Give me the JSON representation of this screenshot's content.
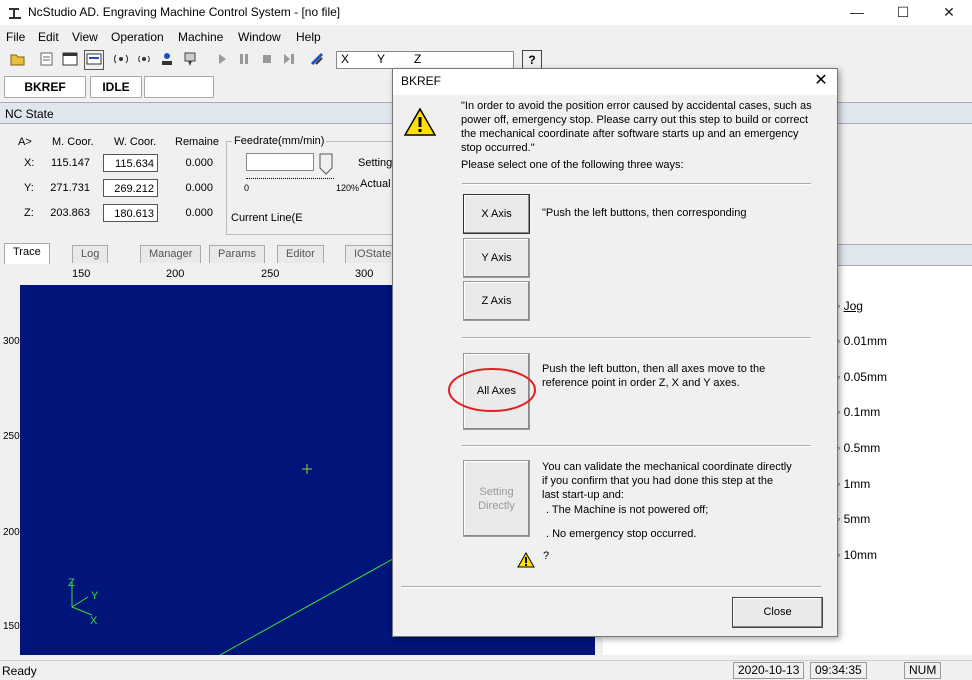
{
  "window": {
    "title": "NcStudio AD. Engraving Machine Control System  - [no file]",
    "minimize_glyph": "—",
    "maximize_glyph": "☐",
    "close_glyph": "✕"
  },
  "menu": [
    "File",
    "Edit",
    "View",
    "Operation",
    "Machine",
    "Window",
    "Help"
  ],
  "toolbar": {
    "axis_labels": [
      "X",
      "Y",
      "Z"
    ],
    "help_label": "?",
    "icons": [
      "open-icon",
      "edit-icon",
      "view-icon",
      "toggle-view-icon",
      "signal-icon",
      "signal2-icon",
      "user-icon",
      "machine-icon",
      "play-icon",
      "pause-icon",
      "stop-icon",
      "step-icon",
      "tool-icon"
    ]
  },
  "status": {
    "bkref": "BKREF",
    "idle": "IDLE"
  },
  "nc_state": {
    "title": "NC State",
    "col_axis": "A>",
    "col_mcoor": "M. Coor.",
    "col_wcoor": "W. Coor.",
    "col_remain": "Remaine",
    "rows": [
      {
        "axis": "X:",
        "m": "115.147",
        "w": "115.634",
        "r": "0.000"
      },
      {
        "axis": "Y:",
        "m": "271.731",
        "w": "269.212",
        "r": "0.000"
      },
      {
        "axis": "Z:",
        "m": "203.863",
        "w": "180.613",
        "r": "0.000"
      }
    ],
    "feedrate_label": "Feedrate(mm/min)",
    "setting_label": "Setting",
    "actual_label": "Actual",
    "slider_min": "0",
    "slider_max": "120%",
    "current_line_label": "Current Line(E"
  },
  "tabs": [
    "Trace",
    "Log",
    "Manager",
    "Params",
    "Editor",
    "IOState"
  ],
  "ruler": {
    "horizontal": [
      "150",
      "200",
      "250",
      "300"
    ],
    "vertical": [
      "300",
      "250",
      "200",
      "150"
    ]
  },
  "canvas": {
    "bg_color": "#00147a",
    "line_color": "#3cdc3c",
    "axis_x": "X",
    "axis_y": "Y",
    "axis_z": "Z",
    "crosshair": "+"
  },
  "jog": {
    "label": "Jog",
    "options": [
      "0.01mm",
      "0.05mm",
      "0.1mm",
      "0.5mm",
      "1mm",
      "5mm",
      "10mm"
    ]
  },
  "statusbar": {
    "ready": "Ready",
    "date": "2020-10-13",
    "time": "09:34:35",
    "num": "NUM"
  },
  "dialog": {
    "title": "BKREF",
    "intro": "\"In order to avoid the position error caused by accidental cases, such as power off, emergency stop. Please carry out this step to build or correct the mechanical coordinate after software starts up and an emergency stop occurred.\"",
    "select_prompt": "Please select one of the following three ways:",
    "x_axis_btn": "X Axis",
    "y_axis_btn": "Y Axis",
    "z_axis_btn": "Z Axis",
    "axis_hint": "\"Push the left buttons, then corresponding",
    "all_axes_btn": "All Axes",
    "all_axes_hint": "Push the left button, then all axes move to the reference point in order Z, X and Y axes.",
    "setting_directly_btn": "Setting Directly",
    "setting_hint": "You can validate the mechanical coordinate directly if you confirm that you had done this step at the last start-up and:",
    "cond1": ". The Machine is not powered off;",
    "cond2": ". No emergency stop occurred.",
    "question": "?",
    "close_btn": "Close",
    "highlight_color": "#e02020",
    "warning_color": "#ffe000"
  }
}
